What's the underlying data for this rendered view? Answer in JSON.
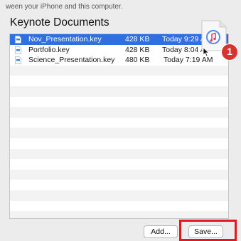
{
  "intro_text": "ween your iPhone and this computer.",
  "section_title": "Keynote Documents",
  "files": [
    {
      "name": "Nov_Presentation.key",
      "size": "428 KB",
      "date": "Today 9:29 A",
      "selected": true
    },
    {
      "name": "Portfolio.key",
      "size": "428 KB",
      "date": "Today 8:04 A",
      "selected": false
    },
    {
      "name": "Science_Presentation.key",
      "size": "480 KB",
      "date": "Today 7:19 AM",
      "selected": false
    }
  ],
  "buttons": {
    "add_label": "Add...",
    "save_label": "Save..."
  },
  "drag_icon": "music-file-icon",
  "step_badge": "1",
  "colors": {
    "selection": "#2f6fe0",
    "highlight": "#e8161c",
    "badge": "#d6342c"
  }
}
